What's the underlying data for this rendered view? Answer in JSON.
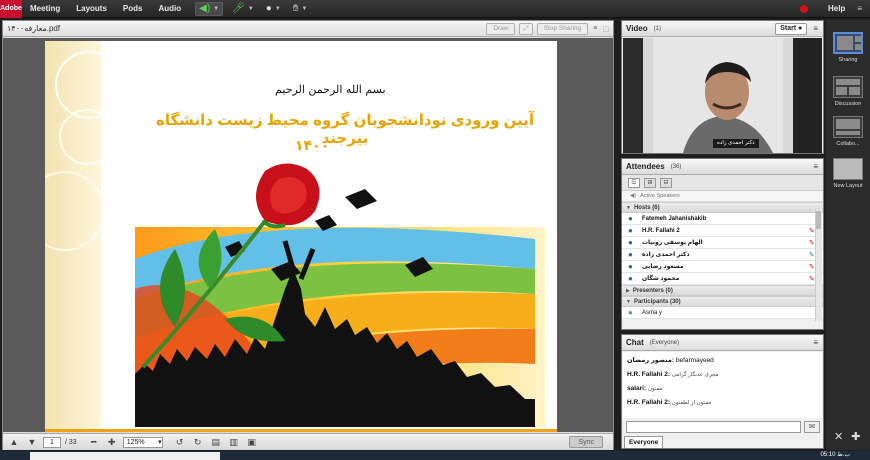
{
  "menubar": {
    "logo": "Adobe",
    "items": [
      "Meeting",
      "Layouts",
      "Pods",
      "Audio"
    ],
    "help": "Help"
  },
  "share_pod": {
    "filename": "۱۴۰۰معارفه.pdf",
    "buttons": {
      "draw": "Draw",
      "stop_sharing": "Stop Sharing"
    }
  },
  "slide": {
    "basmala": "بسم الله الرحمن الرحيم",
    "title": "آیین ورودی نودانشجویان گروه محیط زیست دانشگاه بیرجند",
    "year": "۱۴۰۰"
  },
  "doc_toolbar": {
    "page": "1",
    "total": "/ 33",
    "zoom": "125%",
    "sync": "Sync"
  },
  "video_pod": {
    "title": "Video",
    "count": "(1)",
    "start": "Start",
    "name_tag": "دکتر احمدی زاده"
  },
  "attendees_pod": {
    "title": "Attendees",
    "count": "(36)",
    "active_speakers": "Active Speakers",
    "hosts_label": "Hosts (6)",
    "hosts": [
      {
        "name": "Fatemeh Jahanishakib"
      },
      {
        "name": "H.R. Fallahi 2"
      },
      {
        "name": "الهام یوسفی روبیات"
      },
      {
        "name": "دکتر احمدی زاده"
      },
      {
        "name": "مسعود رضایی"
      },
      {
        "name": "محمود شگان"
      }
    ],
    "presenters_label": "Presenters (0)",
    "participants_label": "Participants (30)",
    "participants": [
      {
        "name": "Asma y"
      }
    ]
  },
  "chat_pod": {
    "title": "Chat",
    "scope": "(Everyone)",
    "messages": [
      {
        "who": "منصور رمضان: ",
        "msg": "befarmayeed"
      },
      {
        "who": "H.R. Fallahi 2: ",
        "msg": "مجری عدنگار گرامی"
      },
      {
        "who": "salari: ",
        "msg": "ممنون"
      },
      {
        "who": "H.R. Fallahi 2: ",
        "msg": "ممنون از لطفتون"
      }
    ],
    "tab": "Everyone"
  },
  "layouts": {
    "items": [
      {
        "label": "Sharing"
      },
      {
        "label": "Discussion"
      },
      {
        "label": "Collabo..."
      },
      {
        "label": "New Layout"
      }
    ]
  },
  "taskbar": {
    "clock": "05:10 ب.ظ"
  },
  "icons": {
    "mic": "microphone-icon",
    "webcam": "webcam-icon",
    "speaker": "speaker-icon",
    "status": "raise-hand-icon"
  },
  "colors": {
    "accent_title": "#e8a400",
    "record": "#d21414",
    "band": "#f2a20c"
  }
}
